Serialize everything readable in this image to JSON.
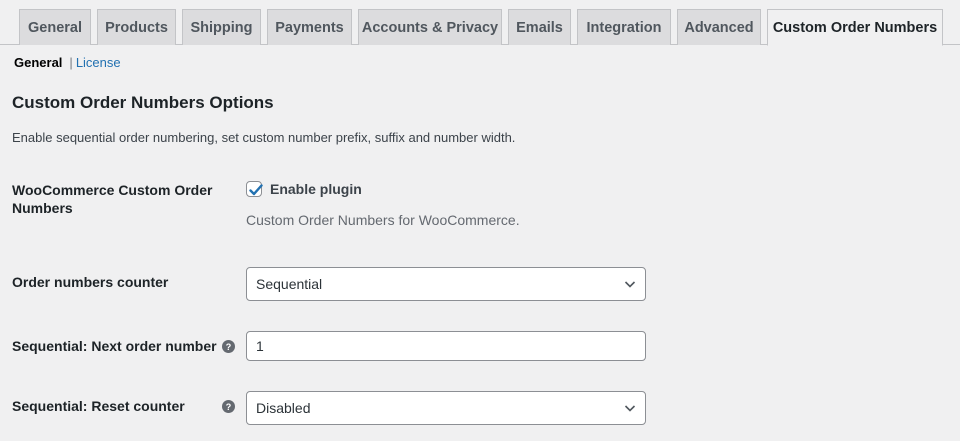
{
  "tabs": [
    {
      "label": "General"
    },
    {
      "label": "Products"
    },
    {
      "label": "Shipping"
    },
    {
      "label": "Payments"
    },
    {
      "label": "Accounts & Privacy"
    },
    {
      "label": "Emails"
    },
    {
      "label": "Integration"
    },
    {
      "label": "Advanced"
    },
    {
      "label": "Custom Order Numbers",
      "active": true
    }
  ],
  "subnav": {
    "current": "General",
    "separator": "|",
    "license": "License"
  },
  "section": {
    "title": "Custom Order Numbers Options",
    "description": "Enable sequential order numbering, set custom number prefix, suffix and number width."
  },
  "settings": {
    "enable": {
      "label_line1": "WooCommerce Custom Order",
      "label_line2": "Numbers",
      "checkbox_label": "Enable plugin",
      "checked": true,
      "description": "Custom Order Numbers for WooCommerce."
    },
    "counter": {
      "label": "Order numbers counter",
      "value": "Sequential"
    },
    "next_number": {
      "label": "Sequential: Next order number",
      "value": "1"
    },
    "reset": {
      "label": "Sequential: Reset counter",
      "value": "Disabled"
    }
  },
  "icons": {
    "help": "help-question-icon",
    "chevron": "chevron-down-icon",
    "check": "checkmark-icon"
  },
  "colors": {
    "link": "#2271b1",
    "checkbox_check": "#2271b1",
    "background": "#f0f0f1",
    "tab_inactive": "#dcdcde"
  }
}
